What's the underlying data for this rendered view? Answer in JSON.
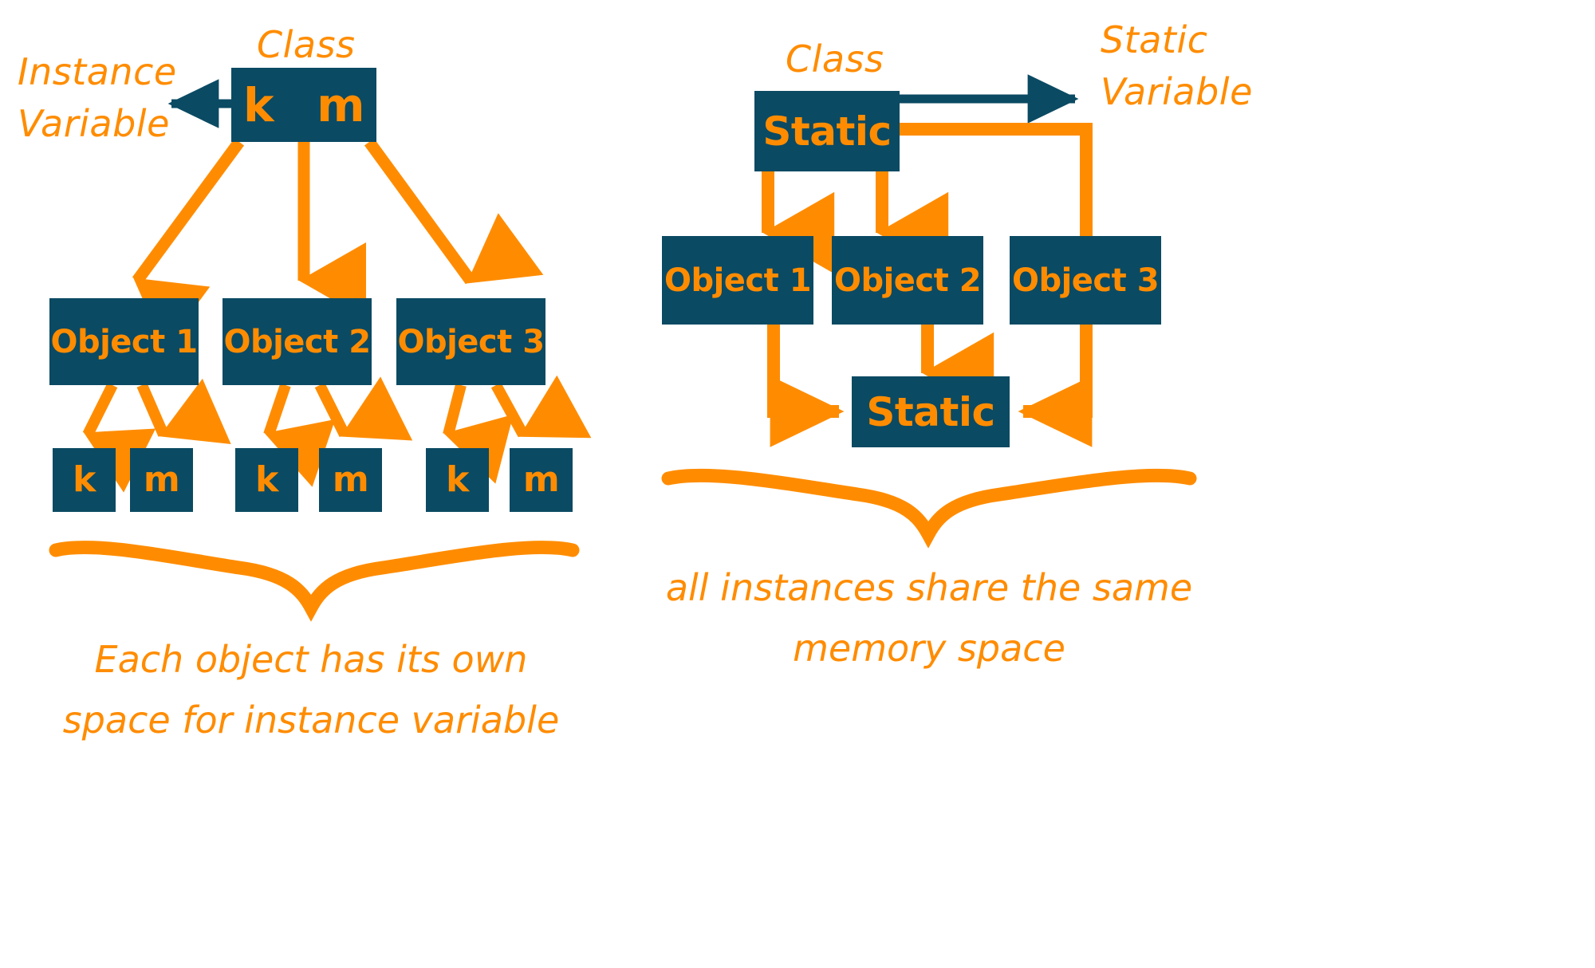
{
  "meta": {
    "title": "Instance Variable vs Static Variable",
    "colors": {
      "box_fill": "#0b4a63",
      "accent_orange": "#FF8C00",
      "arrow_teal": "#0b4a63",
      "background": "#ffffff"
    }
  },
  "left_diagram": {
    "labels": {
      "instance_variable": "Instance\nVariable",
      "class": "Class"
    },
    "class_box": {
      "fields": [
        "k",
        "m"
      ]
    },
    "objects": [
      {
        "label": "Object 1",
        "fields": [
          "k",
          "m"
        ]
      },
      {
        "label": "Object 2",
        "fields": [
          "k",
          "m"
        ]
      },
      {
        "label": "Object 3",
        "fields": [
          "k",
          "m"
        ]
      }
    ],
    "caption": "Each object has its own\nspace for instance variable"
  },
  "right_diagram": {
    "labels": {
      "class": "Class",
      "static_variable": "Static\nVariable"
    },
    "class_box": {
      "label": "Static"
    },
    "objects": [
      {
        "label": "Object 1"
      },
      {
        "label": "Object 2"
      },
      {
        "label": "Object 3"
      }
    ],
    "shared_memory_box": {
      "label": "Static"
    },
    "caption": "all instances share the same\nmemory space"
  }
}
